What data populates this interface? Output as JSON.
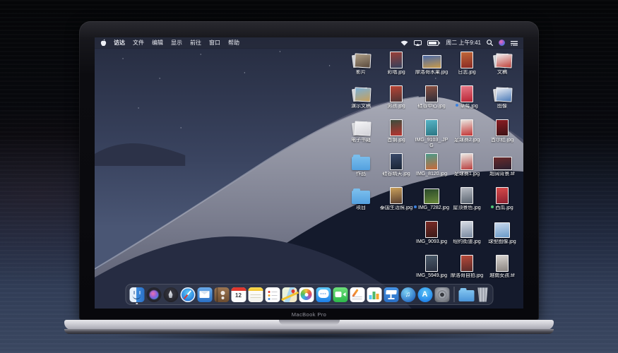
{
  "device": {
    "label": "MacBook Pro"
  },
  "menu_bar": {
    "apple_icon": "apple-logo",
    "menus": [
      "访达",
      "文件",
      "编辑",
      "显示",
      "前往",
      "窗口",
      "帮助"
    ],
    "status": {
      "icons": [
        "wifi",
        "airplay",
        "battery",
        "spotlight",
        "siri",
        "notification-center"
      ],
      "time": "周二 上午9:41"
    }
  },
  "wallpaper": {
    "name": "mojave-night-dunes",
    "sky_top": "#262c40",
    "sky_bottom": "#4a5674",
    "dune_light": "#a8aab6",
    "dune_shadow": "#141a2c"
  },
  "desktop": {
    "label_color": "#ffffff",
    "folder_color": "#53a0df",
    "tag_colors": {
      "blue": "#3b82e0",
      "green": "#4fc878"
    },
    "icons": [
      {
        "label": "影片",
        "kind": "stack",
        "col": 1,
        "row": 1,
        "colors": [
          "#b0a088",
          "#5a4a3c"
        ]
      },
      {
        "label": "彩墙.jpg",
        "kind": "file",
        "shape": "portrait",
        "col": 2,
        "row": 1,
        "colors": [
          "#9a4038",
          "#34405c"
        ]
      },
      {
        "label": "摩洛哥水果.jpg",
        "kind": "file",
        "shape": "landscape",
        "col": 3,
        "row": 1,
        "colors": [
          "#4a6aa8",
          "#c89a4a"
        ]
      },
      {
        "label": "日志.jpg",
        "kind": "file",
        "shape": "portrait",
        "col": 4,
        "row": 1,
        "colors": [
          "#c06838",
          "#8a2a24"
        ]
      },
      {
        "label": "文稿",
        "kind": "stack",
        "col": 5,
        "row": 1,
        "colors": [
          "#f0f0f2",
          "#c04038"
        ]
      },
      {
        "label": "演示文稿",
        "kind": "stack",
        "col": 1,
        "row": 2,
        "colors": [
          "#7ab0d8",
          "#c8a05a"
        ]
      },
      {
        "label": "男孩.jpg",
        "kind": "file",
        "shape": "portrait",
        "col": 2,
        "row": 2,
        "colors": [
          "#b84434",
          "#503434"
        ]
      },
      {
        "label": "硅谷中心.jpg",
        "kind": "file",
        "shape": "portrait",
        "col": 3,
        "row": 2,
        "colors": [
          "#8a5040",
          "#2e2e3a"
        ]
      },
      {
        "label": "草莓.jpg",
        "kind": "file",
        "shape": "portrait",
        "col": 4,
        "row": 2,
        "tag": "#3b82e0",
        "colors": [
          "#e87a88",
          "#b82434"
        ]
      },
      {
        "label": "图像",
        "kind": "stack",
        "col": 5,
        "row": 2,
        "colors": [
          "#eceef4",
          "#4a7ab8"
        ]
      },
      {
        "label": "电子书籍",
        "kind": "stack",
        "col": 1,
        "row": 3,
        "colors": [
          "#f4f4f6",
          "#d2d2d8"
        ]
      },
      {
        "label": "首钢.jpg",
        "kind": "file",
        "shape": "portrait",
        "col": 2,
        "row": 3,
        "colors": [
          "#3c4c3c",
          "#b83430"
        ]
      },
      {
        "label": "IMG_9103_.JPG",
        "kind": "file",
        "shape": "portrait",
        "col": 3,
        "row": 3,
        "colors": [
          "#56b4c6",
          "#2a7684"
        ]
      },
      {
        "label": "足球赛2.jpg",
        "kind": "file",
        "shape": "portrait",
        "col": 4,
        "row": 3,
        "colors": [
          "#eae4de",
          "#c23434"
        ]
      },
      {
        "label": "首尔红.jpg",
        "kind": "file",
        "shape": "portrait",
        "col": 5,
        "row": 3,
        "colors": [
          "#8a1c22",
          "#3c1216"
        ]
      },
      {
        "label": "作品",
        "kind": "folder",
        "col": 1,
        "row": 4,
        "colors": [
          "#79bdec",
          "#53a0df"
        ]
      },
      {
        "label": "硅谷晴天.jpg",
        "kind": "file",
        "shape": "portrait",
        "col": 2,
        "row": 4,
        "colors": [
          "#3a4a6a",
          "#1a2535"
        ]
      },
      {
        "label": "IMG_8120.jpg",
        "kind": "file",
        "shape": "portrait",
        "col": 3,
        "row": 4,
        "colors": [
          "#4a9a8a",
          "#c86a3a"
        ]
      },
      {
        "label": "足球赛1.jpg",
        "kind": "file",
        "shape": "portrait",
        "col": 4,
        "row": 4,
        "colors": [
          "#ece8e2",
          "#b84040"
        ]
      },
      {
        "label": "超阔背景.tif",
        "kind": "file",
        "shape": "landscape",
        "col": 5,
        "row": 4,
        "colors": [
          "#6a2a2a",
          "#2a2030"
        ]
      },
      {
        "label": "项目",
        "kind": "folder",
        "col": 1,
        "row": 5,
        "colors": [
          "#79bdec",
          "#53a0df"
        ]
      },
      {
        "label": "泰国生活照.jpg",
        "kind": "file",
        "shape": "portrait",
        "col": 2,
        "row": 5,
        "colors": [
          "#caa05a",
          "#5a4030"
        ]
      },
      {
        "label": "IMG_7282.jpg",
        "kind": "file",
        "shape": "square",
        "col": 3,
        "row": 5,
        "tag": "#3b82e0",
        "colors": [
          "#2a4a2a",
          "#6a8a3a"
        ]
      },
      {
        "label": "屋顶景色.jpg",
        "kind": "file",
        "shape": "portrait",
        "col": 4,
        "row": 5,
        "colors": [
          "#b8bcc4",
          "#5a6470"
        ]
      },
      {
        "label": "西瓜.jpg",
        "kind": "file",
        "shape": "portrait",
        "col": 5,
        "row": 5,
        "tag": "#4fc878",
        "colors": [
          "#d84a4a",
          "#8a2030"
        ]
      },
      {
        "label": "IMG_9093.jpg",
        "kind": "file",
        "shape": "portrait",
        "col": 3,
        "row": 6,
        "colors": [
          "#7a2a25",
          "#3a1a18"
        ]
      },
      {
        "label": "纽约街道.jpg",
        "kind": "file",
        "shape": "portrait",
        "col": 4,
        "row": 6,
        "colors": [
          "#d8dce4",
          "#7a8aa0"
        ]
      },
      {
        "label": "球型图像.jpg",
        "kind": "file",
        "shape": "square",
        "col": 5,
        "row": 6,
        "colors": [
          "#c8d8ec",
          "#6a9ac8"
        ]
      },
      {
        "label": "IMG_5949.jpg",
        "kind": "file",
        "shape": "portrait",
        "col": 3,
        "row": 7,
        "colors": [
          "#4a5a6a",
          "#2a3040"
        ]
      },
      {
        "label": "摩洛哥自拍.jpg",
        "kind": "file",
        "shape": "portrait",
        "col": 4,
        "row": 7,
        "colors": [
          "#b84a3a",
          "#5a2a28"
        ]
      },
      {
        "label": "越南女孩.tif",
        "kind": "file",
        "shape": "portrait",
        "col": 5,
        "row": 7,
        "colors": [
          "#d8d4d0",
          "#8a8480"
        ]
      }
    ]
  },
  "dock": {
    "apps": [
      {
        "id": "finder",
        "name": "Finder",
        "running": true
      },
      {
        "id": "siri",
        "name": "Siri"
      },
      {
        "id": "launchpad",
        "name": "Launchpad"
      },
      {
        "id": "safari",
        "name": "Safari"
      },
      {
        "id": "mail",
        "name": "Mail"
      },
      {
        "id": "contacts",
        "name": "Contacts"
      },
      {
        "id": "calendar",
        "name": "Calendar",
        "badge_day": "12"
      },
      {
        "id": "notes",
        "name": "Notes"
      },
      {
        "id": "reminders",
        "name": "Reminders"
      },
      {
        "id": "maps",
        "name": "Maps"
      },
      {
        "id": "photos",
        "name": "Photos"
      },
      {
        "id": "messages",
        "name": "Messages"
      },
      {
        "id": "facetime",
        "name": "FaceTime"
      },
      {
        "id": "pages",
        "name": "Pages"
      },
      {
        "id": "numbers",
        "name": "Numbers"
      },
      {
        "id": "keynote",
        "name": "Keynote"
      },
      {
        "id": "itunes",
        "name": "iTunes",
        "glyph": "♫"
      },
      {
        "id": "appstore",
        "name": "App Store",
        "glyph": "A"
      },
      {
        "id": "sysprefs",
        "name": "System Preferences"
      }
    ],
    "downloads": {
      "name": "Downloads"
    },
    "trash": {
      "name": "Trash"
    }
  }
}
